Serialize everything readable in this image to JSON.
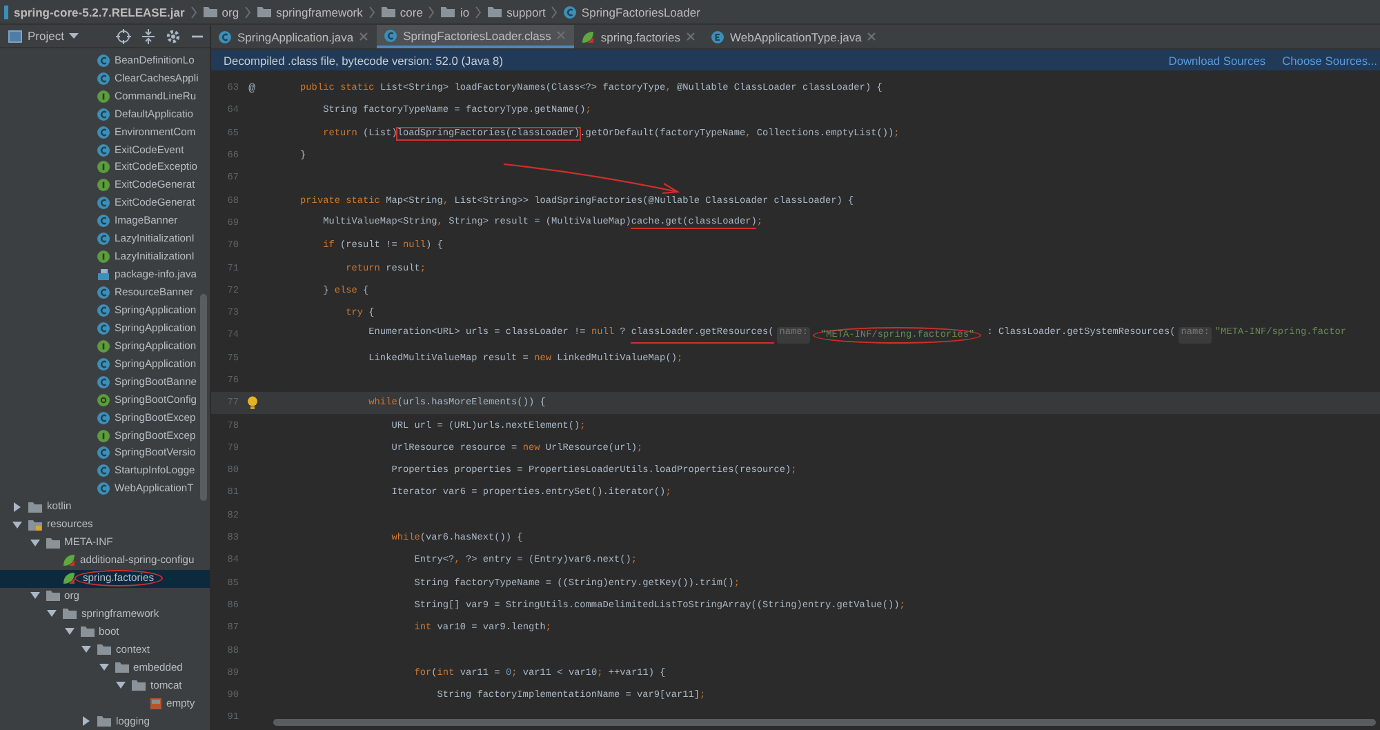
{
  "breadcrumbs": [
    {
      "label": "spring-core-5.2.7.RELEASE.jar",
      "kind": "jar"
    },
    {
      "label": "org",
      "kind": "folder"
    },
    {
      "label": "springframework",
      "kind": "folder"
    },
    {
      "label": "core",
      "kind": "folder"
    },
    {
      "label": "io",
      "kind": "folder"
    },
    {
      "label": "support",
      "kind": "folder"
    },
    {
      "label": "SpringFactoriesLoader",
      "kind": "class"
    }
  ],
  "project_panel": {
    "title": "Project"
  },
  "tabs": [
    {
      "label": "SpringApplication.java",
      "kind": "class",
      "selected": false
    },
    {
      "label": "SpringFactoriesLoader.class",
      "kind": "class",
      "selected": true
    },
    {
      "label": "spring.factories",
      "kind": "spring",
      "selected": false
    },
    {
      "label": "WebApplicationType.java",
      "kind": "enum",
      "selected": false
    }
  ],
  "banner": {
    "text": "Decompiled .class file, bytecode version: 52.0 (Java 8)",
    "links": [
      "Download Sources",
      "Choose Sources..."
    ]
  },
  "tree": {
    "partial_items": [
      {
        "label": "BeanDefinitionLo",
        "kind": "class"
      },
      {
        "label": "ClearCachesAppli",
        "kind": "class"
      },
      {
        "label": "CommandLineRu",
        "kind": "interface"
      },
      {
        "label": "DefaultApplicatio",
        "kind": "class"
      },
      {
        "label": "EnvironmentCom",
        "kind": "class"
      },
      {
        "label": "ExitCodeEvent",
        "kind": "class"
      },
      {
        "label": "ExitCodeExceptio",
        "kind": "interface"
      },
      {
        "label": "ExitCodeGenerat",
        "kind": "interface"
      },
      {
        "label": "ExitCodeGenerat",
        "kind": "class"
      },
      {
        "label": "ImageBanner",
        "kind": "class"
      },
      {
        "label": "LazyInitializationI",
        "kind": "class"
      },
      {
        "label": "LazyInitializationI",
        "kind": "interface"
      },
      {
        "label": "package-info.java",
        "kind": "file"
      },
      {
        "label": "ResourceBanner",
        "kind": "class"
      },
      {
        "label": "SpringApplication",
        "kind": "class"
      },
      {
        "label": "SpringApplication",
        "kind": "class"
      },
      {
        "label": "SpringApplication",
        "kind": "interface"
      },
      {
        "label": "SpringApplication",
        "kind": "class"
      },
      {
        "label": "SpringBootBanne",
        "kind": "class"
      },
      {
        "label": "SpringBootConfig",
        "kind": "annotation"
      },
      {
        "label": "SpringBootExcep",
        "kind": "class"
      },
      {
        "label": "SpringBootExcep",
        "kind": "interface"
      },
      {
        "label": "SpringBootVersio",
        "kind": "class"
      },
      {
        "label": "StartupInfoLogge",
        "kind": "class"
      },
      {
        "label": "WebApplicationT",
        "kind": "class"
      }
    ],
    "items": [
      {
        "label": "kotlin",
        "kind": "folder",
        "expanded": false,
        "selected": false,
        "circled": false
      },
      {
        "label": "resources",
        "kind": "resfolder",
        "expanded": true,
        "selected": false,
        "circled": false,
        "children": [
          {
            "label": "META-INF",
            "kind": "folder",
            "expanded": true,
            "selected": false,
            "circled": false,
            "children": [
              {
                "label": "additional-spring-configu",
                "kind": "spring",
                "selected": false,
                "circled": false
              },
              {
                "label": "spring.factories",
                "kind": "spring",
                "selected": true,
                "circled": true
              }
            ]
          },
          {
            "label": "org",
            "kind": "folder",
            "expanded": true,
            "selected": false,
            "circled": false,
            "children": [
              {
                "label": "springframework",
                "kind": "folder",
                "expanded": true,
                "selected": false,
                "circled": false,
                "children": [
                  {
                    "label": "boot",
                    "kind": "folder",
                    "expanded": true,
                    "selected": false,
                    "circled": false,
                    "children": [
                      {
                        "label": "context",
                        "kind": "folder",
                        "expanded": true,
                        "selected": false,
                        "circled": false,
                        "children": [
                          {
                            "label": "embedded",
                            "kind": "folder",
                            "expanded": true,
                            "selected": false,
                            "circled": false,
                            "children": [
                              {
                                "label": "tomcat",
                                "kind": "folder",
                                "expanded": true,
                                "selected": false,
                                "circled": false,
                                "children": [
                                  {
                                    "label": "empty",
                                    "kind": "json",
                                    "selected": false,
                                    "circled": false
                                  }
                                ]
                              }
                            ]
                          }
                        ]
                      },
                      {
                        "label": "logging",
                        "kind": "folder",
                        "expanded": false,
                        "selected": false,
                        "circled": false
                      }
                    ]
                  }
                ]
              }
            ]
          }
        ]
      }
    ]
  },
  "code_lines": [
    {
      "number": "63",
      "gutter_text": "@",
      "tokens": [
        {
          "kind": "keyword",
          "text": "    public static "
        },
        {
          "kind": "plain",
          "text": "List<String> loadFactoryNames(Class<?> factoryType"
        },
        {
          "kind": "keyword",
          "text": ", "
        },
        {
          "kind": "plain",
          "text": "@Nullable ClassLoader classLoader) {"
        }
      ]
    },
    {
      "number": "64",
      "tokens": [
        {
          "kind": "plain",
          "text": "        String factoryTypeName = factoryType.getName()"
        },
        {
          "kind": "keyword",
          "text": ";"
        }
      ]
    },
    {
      "number": "65",
      "tokens": [
        {
          "kind": "keyword",
          "text": "        return "
        },
        {
          "kind": "plain",
          "text": "(List)"
        },
        {
          "kind": "plain",
          "text": "loadSpringFactories(classLoader)",
          "boxed": true
        },
        {
          "kind": "plain",
          "text": ".getOrDefault(factoryTypeName"
        },
        {
          "kind": "keyword",
          "text": ", "
        },
        {
          "kind": "plain",
          "text": "Collections.emptyList())"
        },
        {
          "kind": "keyword",
          "text": ";"
        }
      ]
    },
    {
      "number": "66",
      "tokens": [
        {
          "kind": "plain",
          "text": "    }"
        }
      ]
    },
    {
      "number": "67",
      "arrow": true
    },
    {
      "number": "68",
      "tokens": [
        {
          "kind": "keyword",
          "text": "    private static "
        },
        {
          "kind": "plain",
          "text": "Map<String"
        },
        {
          "kind": "keyword",
          "text": ", "
        },
        {
          "kind": "plain",
          "text": "List<String>> loadSpringFactories(@Nullable ClassLoader classLoader) {"
        }
      ]
    },
    {
      "number": "69",
      "tokens": [
        {
          "kind": "plain",
          "text": "        MultiValueMap<String"
        },
        {
          "kind": "keyword",
          "text": ", "
        },
        {
          "kind": "plain",
          "text": "String> result = (MultiValueMap)"
        },
        {
          "kind": "plain",
          "text": "cache.get(classLoader)",
          "underlined": true
        },
        {
          "kind": "keyword",
          "text": ";"
        }
      ]
    },
    {
      "number": "70",
      "tokens": [
        {
          "kind": "keyword",
          "text": "        if "
        },
        {
          "kind": "plain",
          "text": "(result != "
        },
        {
          "kind": "keyword",
          "text": "null"
        },
        {
          "kind": "plain",
          "text": ") {"
        }
      ]
    },
    {
      "number": "71",
      "tokens": [
        {
          "kind": "keyword",
          "text": "            return "
        },
        {
          "kind": "plain",
          "text": "result"
        },
        {
          "kind": "keyword",
          "text": ";"
        }
      ]
    },
    {
      "number": "72",
      "tokens": [
        {
          "kind": "plain",
          "text": "        } "
        },
        {
          "kind": "keyword",
          "text": "else "
        },
        {
          "kind": "plain",
          "text": "{"
        }
      ]
    },
    {
      "number": "73",
      "tokens": [
        {
          "kind": "keyword",
          "text": "            try "
        },
        {
          "kind": "plain",
          "text": "{"
        }
      ]
    },
    {
      "number": "74",
      "tokens": [
        {
          "kind": "plain",
          "text": "                Enumeration<URL> urls = classLoader != "
        },
        {
          "kind": "keyword",
          "text": "null "
        },
        {
          "kind": "plain",
          "text": "? "
        },
        {
          "kind": "plain",
          "text": "classLoader.getResources(",
          "underlined": true
        },
        {
          "kind": "hint",
          "text": "name:"
        },
        {
          "kind": "string",
          "text": "\"META-INF/spring.factories\"",
          "circled": true
        },
        {
          "kind": "plain",
          "text": " : ClassLoader.getSystemResources("
        },
        {
          "kind": "hint",
          "text": "name:"
        },
        {
          "kind": "string",
          "text": "\"META-INF/spring.factor"
        }
      ]
    },
    {
      "number": "75",
      "tokens": [
        {
          "kind": "plain",
          "text": "                LinkedMultiValueMap result = "
        },
        {
          "kind": "keyword",
          "text": "new "
        },
        {
          "kind": "plain",
          "text": "LinkedMultiValueMap()"
        },
        {
          "kind": "keyword",
          "text": ";"
        }
      ]
    },
    {
      "number": "76"
    },
    {
      "number": "77",
      "bulb": true,
      "current": true,
      "tokens": [
        {
          "kind": "keyword",
          "text": "                while"
        },
        {
          "kind": "plain",
          "text": "(urls.hasMoreElements()) {"
        }
      ]
    },
    {
      "number": "78",
      "tokens": [
        {
          "kind": "plain",
          "text": "                    URL url = (URL)urls.nextElement()"
        },
        {
          "kind": "keyword",
          "text": ";"
        }
      ]
    },
    {
      "number": "79",
      "tokens": [
        {
          "kind": "plain",
          "text": "                    UrlResource resource = "
        },
        {
          "kind": "keyword",
          "text": "new "
        },
        {
          "kind": "plain",
          "text": "UrlResource(url)"
        },
        {
          "kind": "keyword",
          "text": ";"
        }
      ]
    },
    {
      "number": "80",
      "tokens": [
        {
          "kind": "plain",
          "text": "                    Properties properties = PropertiesLoaderUtils.loadProperties(resource)"
        },
        {
          "kind": "keyword",
          "text": ";"
        }
      ]
    },
    {
      "number": "81",
      "tokens": [
        {
          "kind": "plain",
          "text": "                    Iterator var6 = properties.entrySet().iterator()"
        },
        {
          "kind": "keyword",
          "text": ";"
        }
      ]
    },
    {
      "number": "82"
    },
    {
      "number": "83",
      "tokens": [
        {
          "kind": "keyword",
          "text": "                    while"
        },
        {
          "kind": "plain",
          "text": "(var6.hasNext()) {"
        }
      ]
    },
    {
      "number": "84",
      "tokens": [
        {
          "kind": "plain",
          "text": "                        Entry<?"
        },
        {
          "kind": "keyword",
          "text": ", "
        },
        {
          "kind": "plain",
          "text": "?> entry = (Entry)var6.next()"
        },
        {
          "kind": "keyword",
          "text": ";"
        }
      ]
    },
    {
      "number": "85",
      "tokens": [
        {
          "kind": "plain",
          "text": "                        String factoryTypeName = ((String)entry.getKey()).trim()"
        },
        {
          "kind": "keyword",
          "text": ";"
        }
      ]
    },
    {
      "number": "86",
      "tokens": [
        {
          "kind": "plain",
          "text": "                        String[] var9 = StringUtils.commaDelimitedListToStringArray((String)entry.getValue())"
        },
        {
          "kind": "keyword",
          "text": ";"
        }
      ]
    },
    {
      "number": "87",
      "tokens": [
        {
          "kind": "keyword",
          "text": "                        int "
        },
        {
          "kind": "plain",
          "text": "var10 = var9.length"
        },
        {
          "kind": "keyword",
          "text": ";"
        }
      ]
    },
    {
      "number": "88"
    },
    {
      "number": "89",
      "tokens": [
        {
          "kind": "keyword",
          "text": "                        for"
        },
        {
          "kind": "plain",
          "text": "("
        },
        {
          "kind": "keyword",
          "text": "int "
        },
        {
          "kind": "plain",
          "text": "var11 = "
        },
        {
          "kind": "number",
          "text": "0"
        },
        {
          "kind": "keyword",
          "text": "; "
        },
        {
          "kind": "plain",
          "text": "var11 < var10"
        },
        {
          "kind": "keyword",
          "text": "; "
        },
        {
          "kind": "plain",
          "text": "++var11) {"
        }
      ]
    },
    {
      "number": "90",
      "tokens": [
        {
          "kind": "plain",
          "text": "                            String factoryImplementationName = var9[var11]"
        },
        {
          "kind": "keyword",
          "text": ";"
        }
      ]
    },
    {
      "number": "91"
    }
  ]
}
